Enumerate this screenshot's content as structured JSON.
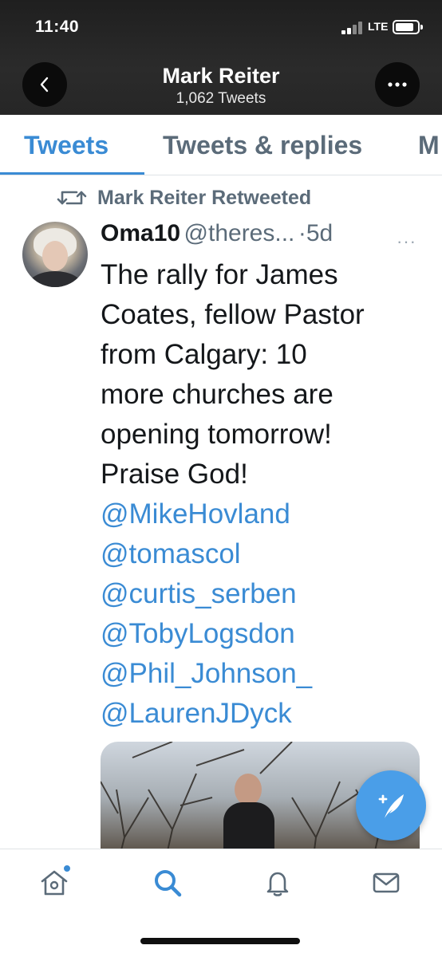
{
  "status_bar": {
    "time": "11:40",
    "network": "LTE",
    "battery_level": 0.85
  },
  "header": {
    "back_icon": "chevron-left-icon",
    "more_icon": "ellipsis-icon",
    "profile_name": "Mark Reiter",
    "tweet_count": "1,062 Tweets"
  },
  "tabs": [
    {
      "label": "Tweets",
      "active": true
    },
    {
      "label": "Tweets & replies",
      "active": false
    },
    {
      "label": "M",
      "active": false
    }
  ],
  "tweet": {
    "retweet_label": "Mark Reiter Retweeted",
    "author": "Oma10",
    "handle": "@theres...",
    "time": "·5d",
    "more": "···",
    "text_lines": [
      "The rally for James",
      "Coates, fellow Pastor",
      "from Calgary: 10",
      "more churches are",
      "opening tomorrow!",
      "Praise God!"
    ],
    "mentions": [
      "@MikeHovland",
      "@tomascol",
      "@curtis_serben",
      "@TobyLogsdon",
      "@Phil_Johnson_",
      "@LaurenJDyck"
    ]
  },
  "compose_button_icon": "compose-tweet-icon",
  "bottom_nav": [
    {
      "name": "home",
      "icon": "home-icon",
      "active": false,
      "has_notification_dot": true
    },
    {
      "name": "search",
      "icon": "search-icon",
      "active": true
    },
    {
      "name": "notifications",
      "icon": "bell-icon",
      "active": false
    },
    {
      "name": "messages",
      "icon": "mail-icon",
      "active": false
    }
  ],
  "colors": {
    "accent": "#3a8bd4",
    "secondary_text": "#5b6b79",
    "header_bg": "#262626",
    "fab": "#4a9ee8"
  }
}
